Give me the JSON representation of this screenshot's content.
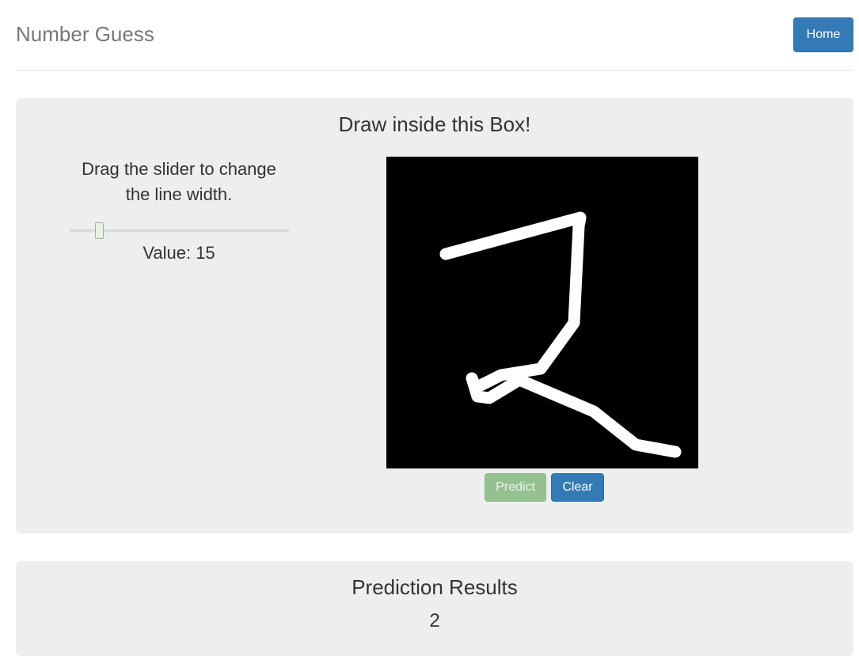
{
  "header": {
    "brand": "Number Guess",
    "home_label": "Home"
  },
  "draw_panel": {
    "title": "Draw inside this Box!",
    "slider_instructions": "Drag the slider to change the line width.",
    "slider_value_text": "Value: 15",
    "slider_value": 15,
    "predict_label": "Predict",
    "clear_label": "Clear"
  },
  "results_panel": {
    "title": "Prediction Results",
    "prediction": "2"
  },
  "colors": {
    "primary": "#337ab7",
    "success_disabled": "#95c191",
    "panel_bg": "#eeeeee",
    "canvas_bg": "#000000",
    "stroke": "#ffffff"
  }
}
